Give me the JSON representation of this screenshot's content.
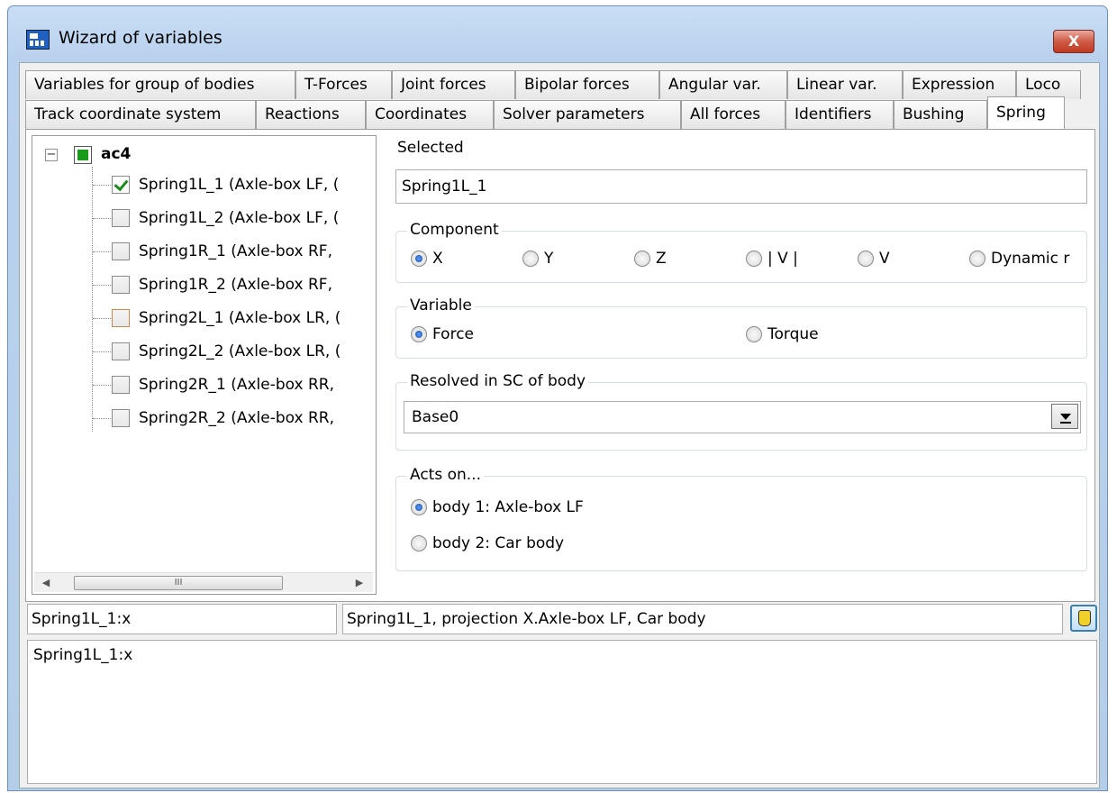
{
  "window": {
    "title": "Wizard of variables",
    "close_label": "X"
  },
  "tabs": {
    "row1": [
      "Variables for group of bodies",
      "T-Forces",
      "Joint forces",
      "Bipolar forces",
      "Angular var.",
      "Linear var.",
      "Expression",
      "Loco"
    ],
    "row2": [
      "Track coordinate system",
      "Reactions",
      "Coordinates",
      "Solver parameters",
      "All forces",
      "Identifiers",
      "Bushing",
      "Spring"
    ],
    "active": "Spring"
  },
  "tree": {
    "root": {
      "label": "ac4",
      "expander": "−"
    },
    "items": [
      {
        "label": "Spring1L_1 (Axle-box LF, (",
        "checked": true
      },
      {
        "label": "Spring1L_2 (Axle-box LF, (",
        "checked": false
      },
      {
        "label": "Spring1R_1 (Axle-box RF,",
        "checked": false
      },
      {
        "label": "Spring1R_2 (Axle-box RF,",
        "checked": false
      },
      {
        "label": "Spring2L_1 (Axle-box LR, (",
        "checked": false
      },
      {
        "label": "Spring2L_2 (Axle-box LR, (",
        "checked": false
      },
      {
        "label": "Spring2R_1 (Axle-box RR,",
        "checked": false
      },
      {
        "label": "Spring2R_2 (Axle-box RR,",
        "checked": false
      }
    ],
    "scroll_grip": "III",
    "scroll_left": "◀",
    "scroll_right": "▶"
  },
  "selected": {
    "label": "Selected",
    "value": "Spring1L_1"
  },
  "component": {
    "title": "Component",
    "options": [
      "X",
      "Y",
      "Z",
      "| V |",
      "V",
      "Dynamic r"
    ],
    "selected": "X"
  },
  "variable": {
    "title": "Variable",
    "options": [
      "Force",
      "Torque"
    ],
    "selected": "Force"
  },
  "resolved": {
    "title": "Resolved in SC of body",
    "value": "Base0"
  },
  "acts_on": {
    "title": "Acts on...",
    "options": [
      "body 1: Axle-box LF",
      "body 2: Car body"
    ],
    "selected": "body 1: Axle-box LF"
  },
  "bottom": {
    "name_field": "Spring1L_1:x",
    "description_field": "Spring1L_1, projection X.Axle-box LF, Car body",
    "output_text": "Spring1L_1:x"
  },
  "icons": {
    "app": "wizard-app-icon",
    "pick": "hand-pointer-icon"
  }
}
